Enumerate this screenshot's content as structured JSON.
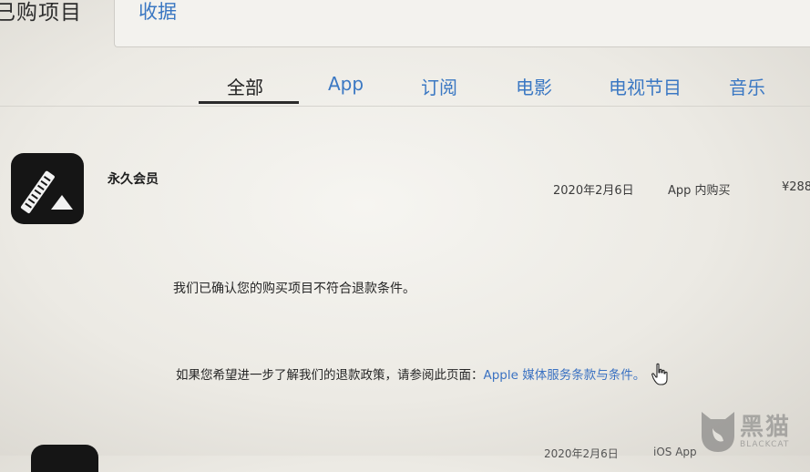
{
  "header": {
    "title": "已购项目",
    "search_value": "收据"
  },
  "tabs": [
    {
      "label": "全部",
      "active": true
    },
    {
      "label": "App",
      "active": false
    },
    {
      "label": "订阅",
      "active": false
    },
    {
      "label": "电影",
      "active": false
    },
    {
      "label": "电视节目",
      "active": false
    },
    {
      "label": "音乐",
      "active": false
    }
  ],
  "purchase": {
    "name": "永久会员",
    "date": "2020年2月6日",
    "type": "App 内购买",
    "price": "¥288"
  },
  "messages": {
    "line1": "我们已确认您的购买项目不符合退款条件。",
    "line2_prefix": "如果您希望进一步了解我们的退款政策，请参阅此页面：",
    "line2_link": "Apple 媒体服务条款与条件。"
  },
  "next_row": {
    "date": "2020年2月6日",
    "type": "iOS App"
  },
  "watermark": {
    "text": "黑猫",
    "sub": "BLACKCAT"
  },
  "colors": {
    "link": "#3b78c3",
    "icon_bg": "#151515"
  },
  "icons": [
    "app-icon",
    "cursor-hand-icon",
    "black-cat-logo-icon"
  ]
}
